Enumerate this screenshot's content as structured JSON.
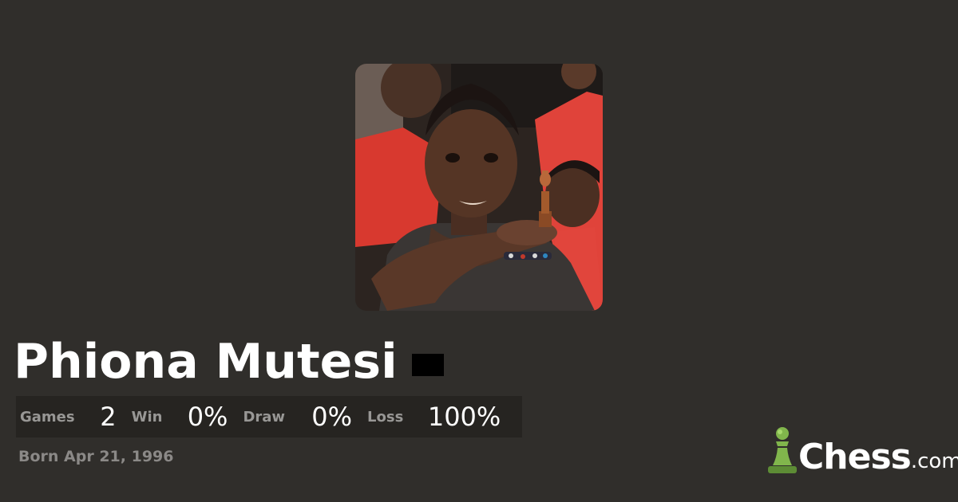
{
  "profile": {
    "name": "Phiona Mutesi",
    "born": "Born Apr 21, 1996",
    "photo_alt": "player-photo"
  },
  "stats": {
    "games_label": "Games",
    "games_value": "2",
    "win_label": "Win",
    "win_value": "0%",
    "draw_label": "Draw",
    "draw_value": "0%",
    "loss_label": "Loss",
    "loss_value": "100%"
  },
  "brand": {
    "name": "Chess",
    "domain": ".com",
    "accent": "#81b64c"
  },
  "colors": {
    "background": "#302e2b",
    "stats_bar": "#262421"
  },
  "icons": {
    "flag": "country-flag-icon",
    "logo": "pawn-logo-icon"
  }
}
